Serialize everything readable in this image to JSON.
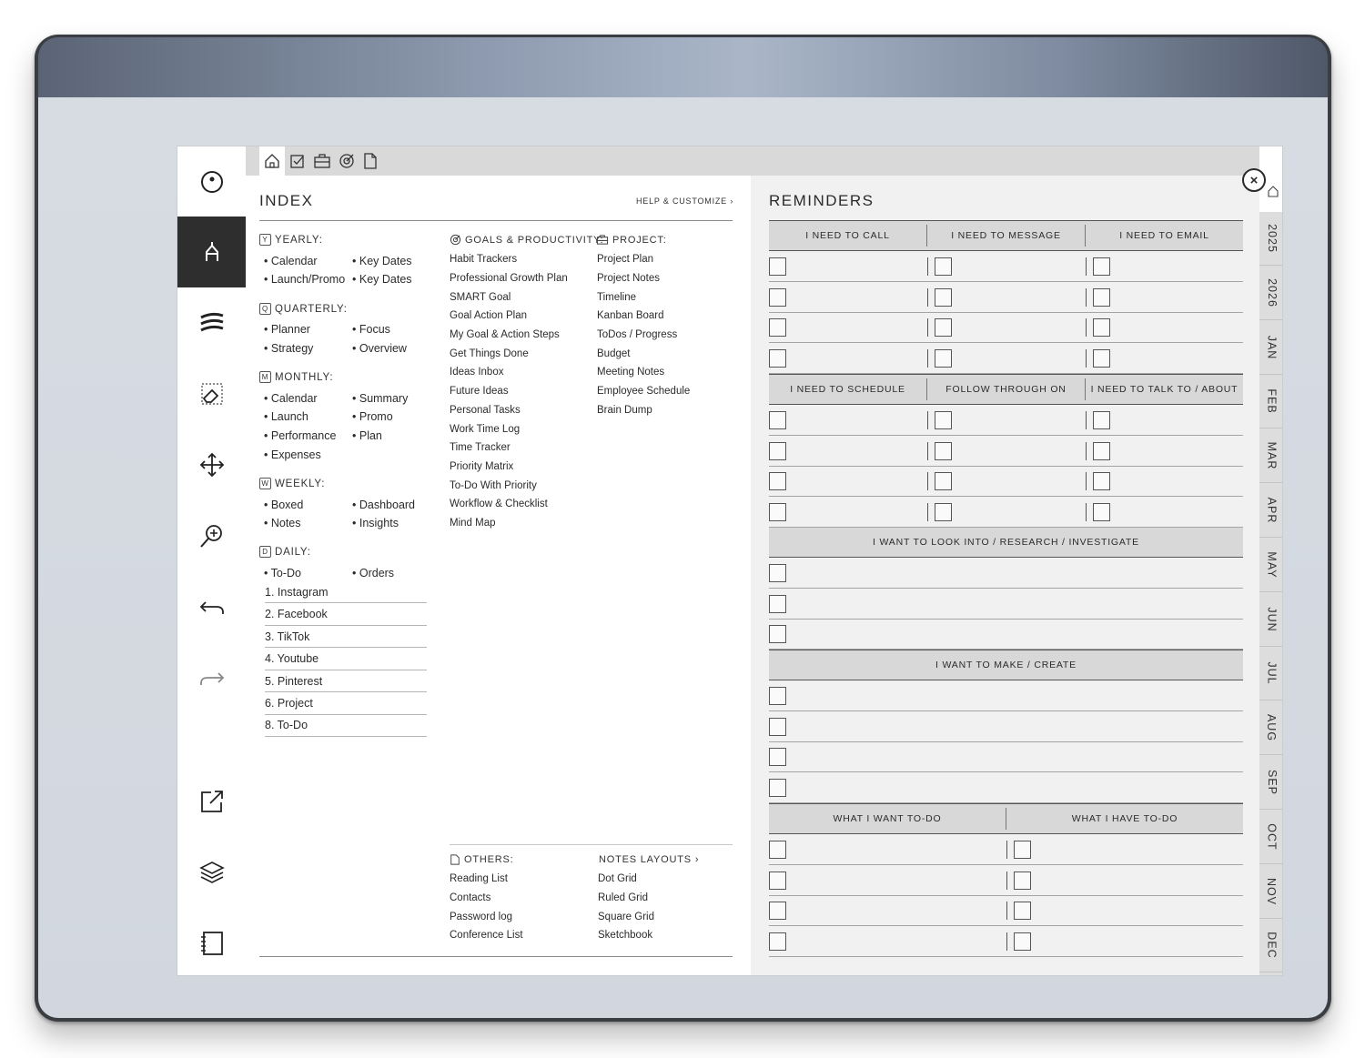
{
  "toolbar": {
    "tools": [
      "menu-circle-icon",
      "pen-tool-icon",
      "pen-options-icon",
      "eraser-icon",
      "move-icon",
      "zoom-icon",
      "undo-icon",
      "redo-icon",
      "share-icon",
      "layers-icon",
      "notebook-icon"
    ]
  },
  "topnav": {
    "icons": [
      "home-icon",
      "checkbox-icon",
      "briefcase-icon",
      "goal-icon",
      "document-icon"
    ]
  },
  "index": {
    "title": "INDEX",
    "help": "HELP & CUSTOMIZE",
    "yearly": {
      "badge": "Y",
      "label": "YEARLY:",
      "items": [
        "Calendar",
        "Key Dates",
        "Launch/Promo",
        "Key Dates"
      ]
    },
    "quarterly": {
      "badge": "Q",
      "label": "QUARTERLY:",
      "items": [
        "Planner",
        "Focus",
        "Strategy",
        "Overview"
      ]
    },
    "monthly": {
      "badge": "M",
      "label": "MONTHLY:",
      "items": [
        "Calendar",
        "Summary",
        "Launch",
        "Promo",
        "Performance",
        "Plan",
        "Expenses"
      ]
    },
    "weekly": {
      "badge": "W",
      "label": "WEEKLY:",
      "items": [
        "Boxed",
        "Dashboard",
        "Notes",
        "Insights"
      ]
    },
    "daily": {
      "badge": "D",
      "label": "DAILY:",
      "items": [
        "To-Do",
        "Orders"
      ],
      "numbered": [
        "1. Instagram",
        "2. Facebook",
        "3. TikTok",
        "4. Youtube",
        "5. Pinterest",
        "6. Project",
        "8. To-Do"
      ]
    },
    "goals": {
      "label": "GOALS & PRODUCTIVITY:",
      "items": [
        "Habit Trackers",
        "Professional Growth Plan",
        "SMART Goal",
        "Goal Action Plan",
        "My Goal & Action Steps",
        "Get Things Done",
        "Ideas Inbox",
        "Future Ideas",
        "Personal Tasks",
        "Work Time Log",
        "Time Tracker",
        "Priority Matrix",
        "To-Do With Priority",
        "Workflow & Checklist",
        "Mind Map"
      ]
    },
    "project": {
      "label": "PROJECT:",
      "items": [
        "Project Plan",
        "Project Notes",
        "Timeline",
        "Kanban Board",
        "ToDos / Progress",
        "Budget",
        "Meeting Notes",
        "Employee Schedule",
        "Brain Dump"
      ]
    },
    "others": {
      "label": "OTHERS:",
      "items": [
        "Reading List",
        "Contacts",
        "Password log",
        "Conference List"
      ]
    },
    "notes_layouts": {
      "label": "NOTES LAYOUTS",
      "items": [
        "Dot Grid",
        "Ruled Grid",
        "Square Grid",
        "Sketchbook"
      ]
    }
  },
  "reminders": {
    "title": "REMINDERS",
    "block1": [
      "I NEED TO CALL",
      "I NEED TO MESSAGE",
      "I NEED TO EMAIL"
    ],
    "block2": [
      "I NEED TO SCHEDULE",
      "FOLLOW THROUGH ON",
      "I NEED TO TALK TO / ABOUT"
    ],
    "block3": "I WANT TO LOOK INTO / RESEARCH / INVESTIGATE",
    "block4": "I WANT TO MAKE / CREATE",
    "block5": [
      "WHAT I WANT TO-DO",
      "WHAT I HAVE TO-DO"
    ]
  },
  "tabs": [
    "2025",
    "2026",
    "JAN",
    "FEB",
    "MAR",
    "APR",
    "MAY",
    "JUN",
    "JUL",
    "AUG",
    "SEP",
    "OCT",
    "NOV",
    "DEC"
  ],
  "colors": {
    "accent_dark": "#2e2e2e",
    "header_gray": "#d8d8d8",
    "tab_gray": "#dddddd"
  }
}
